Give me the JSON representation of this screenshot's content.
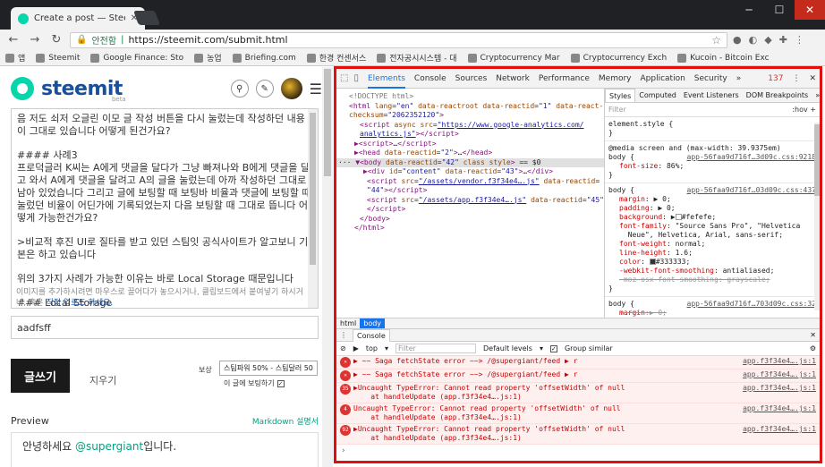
{
  "browser": {
    "tab_title": "Create a post — Steem",
    "url": "https://steemit.com/submit.html",
    "secure_label": "안전함",
    "bookmarks": [
      "앱",
      "Steemit",
      "Google Finance: Sto",
      "농업",
      "Briefing.com",
      "한경 컨센서스",
      "전자공시시스템 - 대",
      "Cryptocurrency Mar",
      "Cryptocurrency Exch",
      "Kucoin - Bitcoin Exc"
    ]
  },
  "steemit": {
    "brand": "steemit",
    "beta": "beta",
    "editor": [
      "음 저도 쇠저 오글린 이모 글 작성 버튼을 다시 눌렀는데 작성하던 내용이 그대로 있습니다 어떻게 된건가요?",
      "#### 사례3\n프로덕글러 K씨는 A에게 댓글을 달다가 그냥 빠져나와 B에게 댓글을 달고 와서 A에게 댓글을 달려고 A의 글을 눌렀는데 아까 작성하던 그대로 남아 있었습니다 그리고 글에 보팅할 때 보팅바 비율과 댓글에 보팅할 때 눌렀던 비율이 어딘가에 기록되었는지 다음 보팅할 때 그대로 뜹니다 어떻게 가능한건가요?",
      ">비교적 후진 UI로 질타를 받고 있던 스팀잇 공식사이트가 알고보니 기본은 하고 있습니다",
      "위의 3가지 사례가 가능한 이유는 바로 Local Storage 때문입니다",
      "### Local Storage"
    ],
    "hint_text": "이미지를 추가하시려면 마우스로 끌어다가 놓으시거나, 클립보드에서 붙여넣기 하시거나, 혹은 ",
    "hint_link": "직접 업로드 하세요.",
    "title_value": "aadfsff",
    "post_label": "글쓰기",
    "clear_label": "지우기",
    "reward_label": "보상",
    "reward_option": "스팀파워 50% - 스팀달러 50",
    "upvote_label": "이 글에 보팅하기",
    "preview_label": "Preview",
    "markdown_label": "Markdown 설명서",
    "preview_text": "안녕하세요 ",
    "preview_mention": "@supergiant",
    "preview_suffix": "입니다."
  },
  "devtools": {
    "tabs": [
      "Elements",
      "Console",
      "Sources",
      "Network",
      "Performance",
      "Memory",
      "Application",
      "Security"
    ],
    "error_count": "137",
    "style_tabs": [
      "Styles",
      "Computed",
      "Event Listeners",
      "DOM Breakpoints"
    ],
    "filter": "Filter",
    "hov": ":hov",
    ".cls": ".cls",
    "crumbs": [
      "html",
      "body"
    ],
    "drawer_tab": "Console",
    "context": "top",
    "filter_ph": "Filter",
    "levels": "Default levels",
    "group": "Group similar"
  },
  "console": [
    {
      "badge": "",
      "text": "▶ ~~ Saga fetchState error ~~> /@supergiant/feed ▶ r",
      "src": "app.f3f34e4….js:1"
    },
    {
      "badge": "",
      "text": "▶ ~~ Saga fetchState error ~~> /@supergiant/feed ▶ r",
      "src": "app.f3f34e4….js:1"
    },
    {
      "badge": "35",
      "text": "▶Uncaught TypeError: Cannot read property 'offsetWidth' of null\n    at handleUpdate (app.f3f34e4….js:1)",
      "src": "app.f3f34e4….js:1"
    },
    {
      "badge": "4",
      "text": "Uncaught TypeError: Cannot read property 'offsetWidth' of null\n    at handleUpdate (app.f3f34e4….js:1)",
      "src": "app.f3f34e4….js:1"
    },
    {
      "badge": "92",
      "text": "▶Uncaught TypeError: Cannot read property 'offsetWidth' of null\n    at handleUpdate (app.f3f34e4….js:1)",
      "src": "app.f3f34e4….js:1"
    }
  ]
}
